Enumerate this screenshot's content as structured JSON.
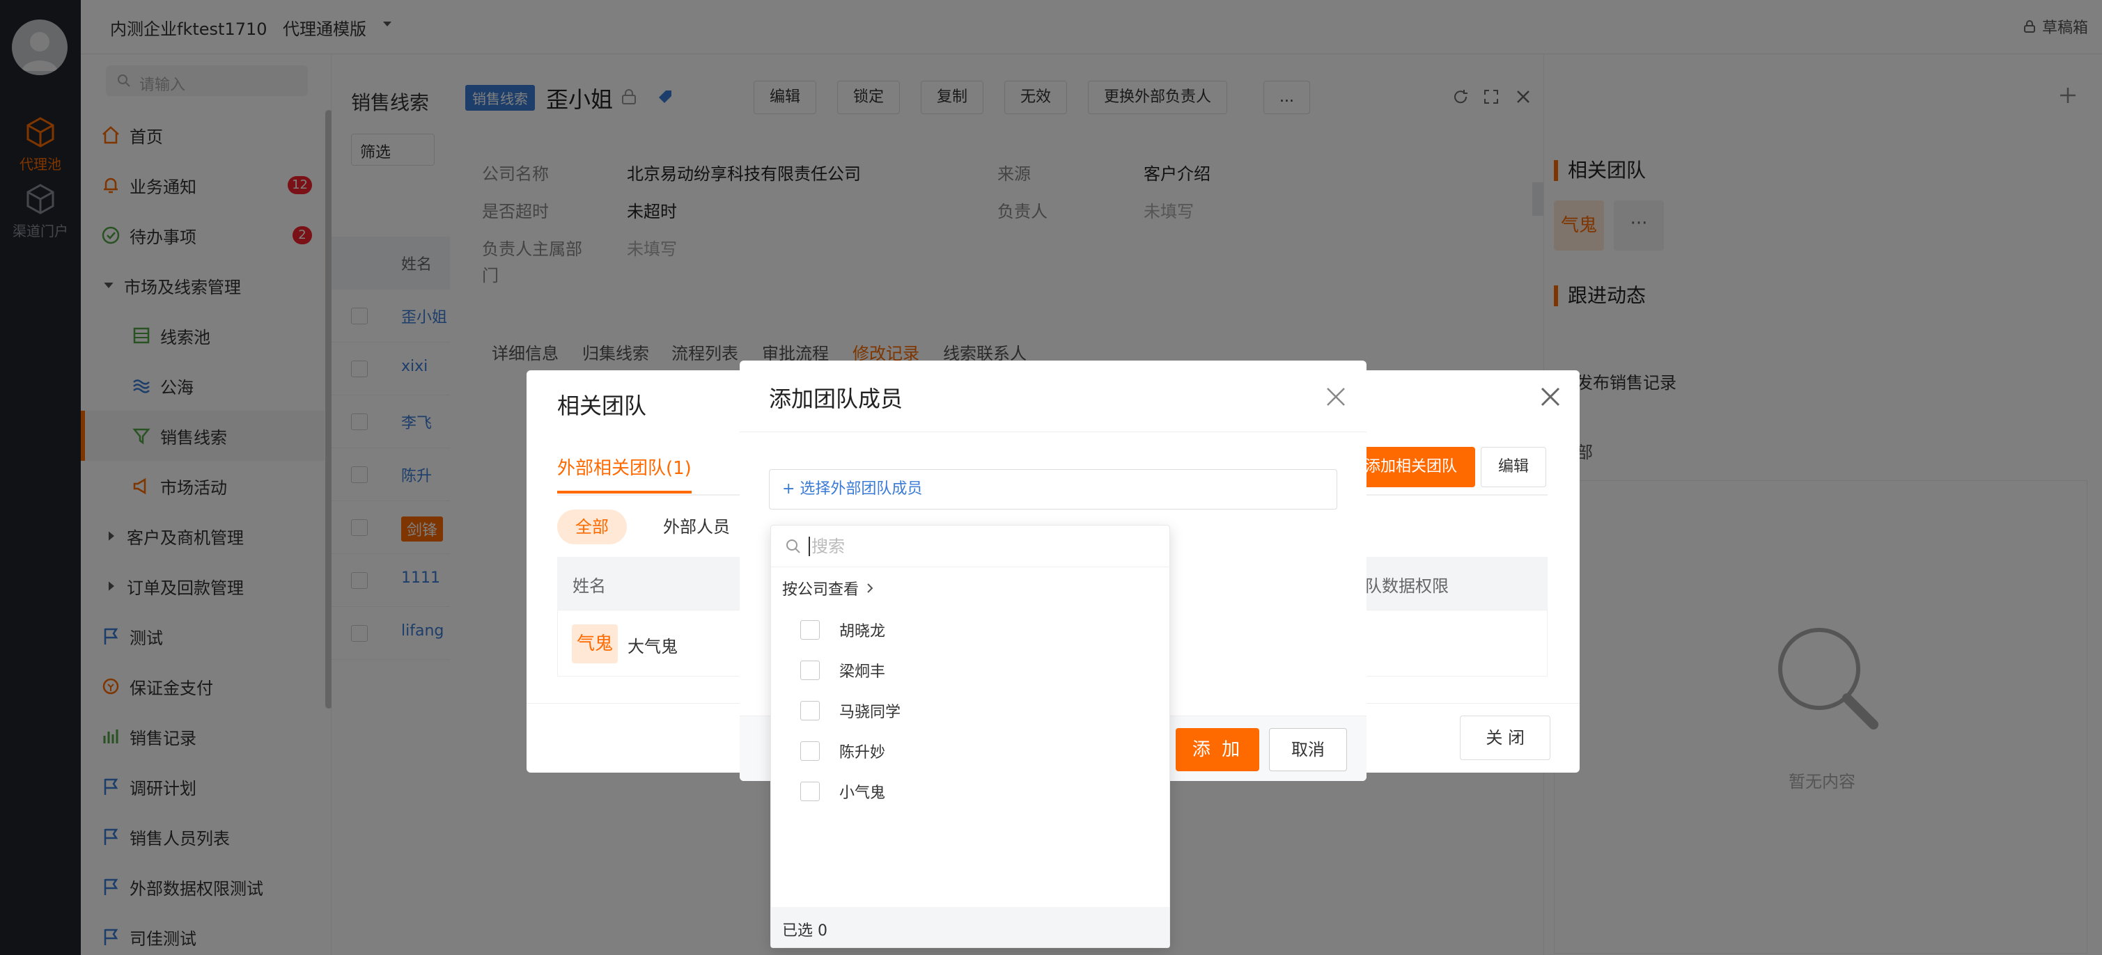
{
  "rail": {
    "items": [
      {
        "label": "代理池",
        "active": true
      },
      {
        "label": "渠道门户",
        "active": false
      }
    ]
  },
  "topbar": {
    "company": "内测企业fktest1710",
    "version": "代理通模版",
    "drafts": "草稿箱"
  },
  "menu": {
    "search_placeholder": "请输入",
    "items": [
      {
        "label": "首页"
      },
      {
        "label": "业务通知",
        "badge": "12"
      },
      {
        "label": "待办事项",
        "badge": "2"
      },
      {
        "label": "市场及线索管理"
      },
      {
        "label": "线索池"
      },
      {
        "label": "公海"
      },
      {
        "label": "销售线索"
      },
      {
        "label": "市场活动"
      },
      {
        "label": "客户及商机管理"
      },
      {
        "label": "订单及回款管理"
      },
      {
        "label": "测试"
      },
      {
        "label": "保证金支付"
      },
      {
        "label": "销售记录"
      },
      {
        "label": "调研计划"
      },
      {
        "label": "销售人员列表"
      },
      {
        "label": "外部数据权限测试"
      },
      {
        "label": "司佳测试"
      }
    ]
  },
  "lead_list": {
    "title": "销售线索",
    "filter": "筛选",
    "col_name": "姓名",
    "rows": [
      "歪小姐",
      "xixi",
      "李飞",
      "陈升",
      "剑锋",
      "1111",
      "lifang"
    ]
  },
  "detail": {
    "tag": "销售线索",
    "name": "歪小姐",
    "actions": [
      "编辑",
      "锁定",
      "复制",
      "无效",
      "更换外部负责人",
      "..."
    ],
    "fields": {
      "company_label": "公司名称",
      "company_value": "北京易动纷享科技有限责任公司",
      "source_label": "来源",
      "source_value": "客户介绍",
      "overtime_label": "是否超时",
      "overtime_value": "未超时",
      "owner_label": "负责人",
      "owner_value": "未填写",
      "dept_label_1": "负责人主属部",
      "dept_label_2": "门",
      "dept_value": "未填写"
    },
    "tabs": [
      "详细信息",
      "归集线索",
      "流程列表",
      "审批流程",
      "修改记录",
      "线索联系人"
    ]
  },
  "right_panel": {
    "team_title": "相关团队",
    "member_avatar": "气鬼",
    "more": "···",
    "follow_title": "跟进动态",
    "publish": "发布销售记录",
    "dept_filter": "部",
    "empty": "暂无内容"
  },
  "team_modal": {
    "title": "相关团队",
    "tab": "外部相关团队(1)",
    "seg_all": "全部",
    "seg_external": "外部人员",
    "col_name": "姓名",
    "col_permission": "队数据权限",
    "row_avatar": "气鬼",
    "row_name": "大气鬼",
    "add_button": "添加相关团队",
    "edit_button": "编辑",
    "close_button": "关 闭"
  },
  "add_modal": {
    "title": "添加团队成员",
    "select_placeholder": "+ 选择外部团队成员",
    "add_button": "添 加",
    "cancel_button": "取消"
  },
  "picker": {
    "search_placeholder": "搜索",
    "by_company": "按公司查看",
    "members": [
      "胡晓龙",
      "梁炯丰",
      "马骁同学",
      "陈升妙",
      "小气鬼"
    ],
    "selected": "已选 0"
  },
  "colors": {
    "accent": "#ff6a00",
    "link": "#3a7bd5",
    "rail": "#22252b"
  }
}
